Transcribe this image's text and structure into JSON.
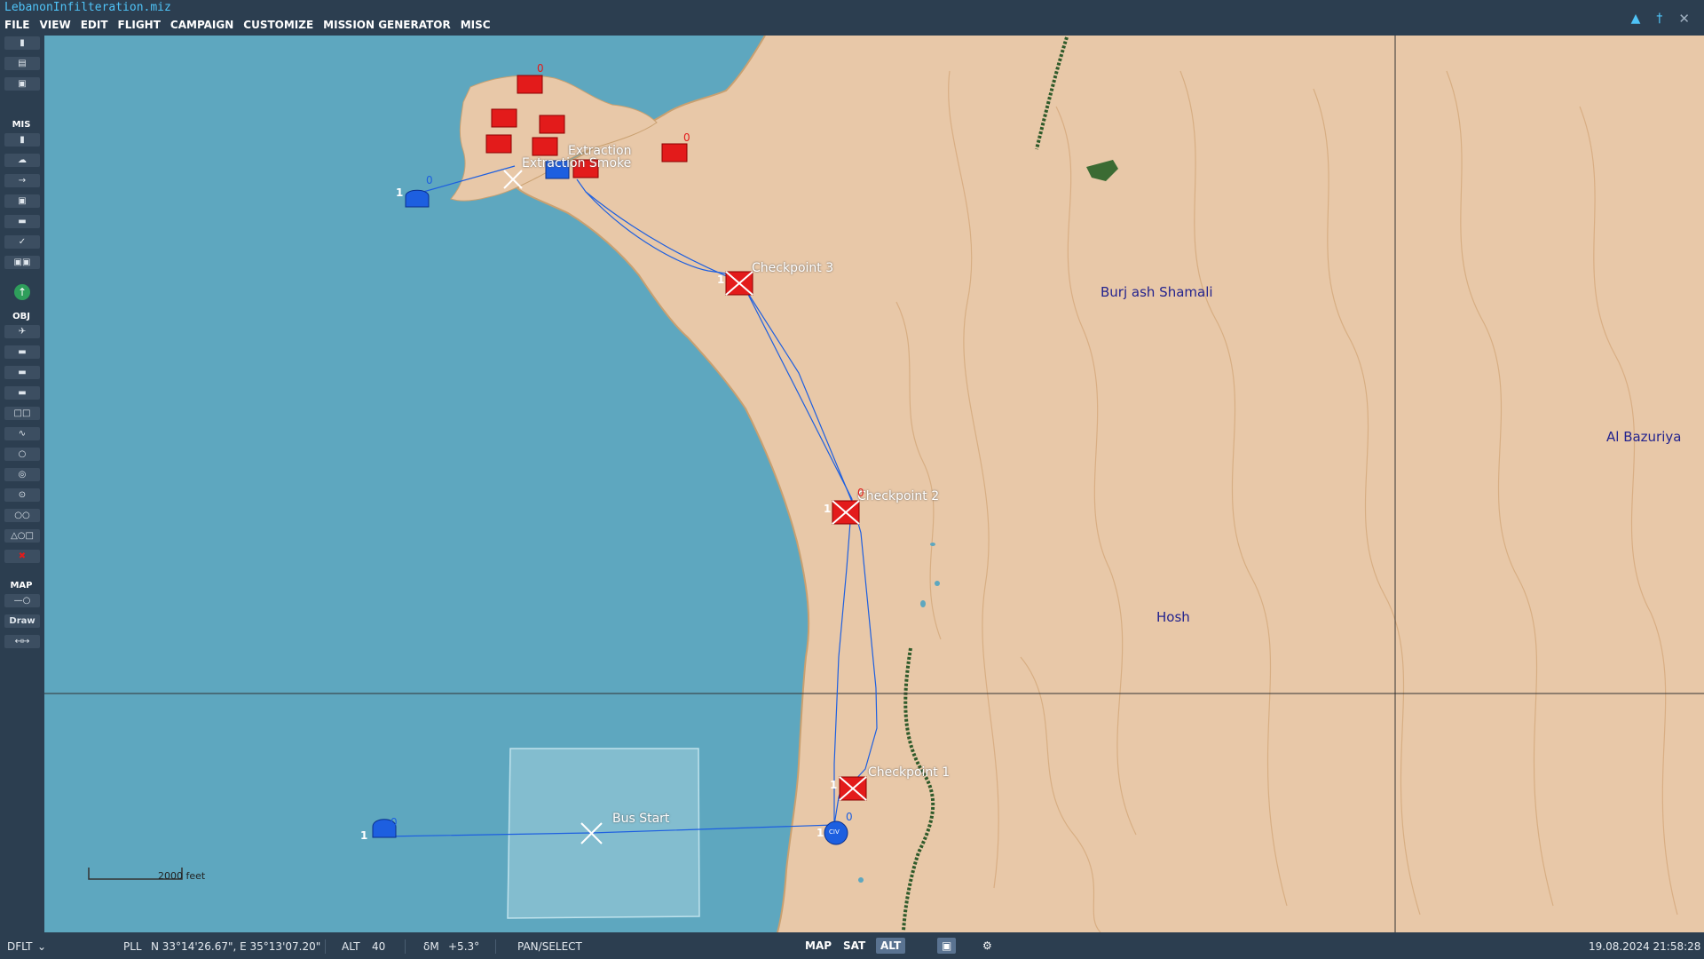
{
  "window": {
    "title": "LebanonInfilteration.miz"
  },
  "menu": [
    "FILE",
    "VIEW",
    "EDIT",
    "FLIGHT",
    "CAMPAIGN",
    "CUSTOMIZE",
    "MISSION GENERATOR",
    "MISC"
  ],
  "toolbar": {
    "mis_label": "MIS",
    "obj_label": "OBJ",
    "map_label": "MAP",
    "draw_label": "Draw"
  },
  "map": {
    "towns": [
      "Burj ash Shamali",
      "Al Bazuriya",
      "Hosh"
    ],
    "waypoints": [
      "Checkpoint 3",
      "Checkpoint 2",
      "Checkpoint 1",
      "Bus Start",
      "Extraction Smoke",
      "Extraction"
    ],
    "group_index": "1",
    "group_zero": "0",
    "civ_label": "CIV",
    "scale_label": "2000 feet"
  },
  "status": {
    "profile": "DFLT",
    "coord_label": "PLL",
    "coords": "N 33°14'26.67\", E 35°13'07.20\"",
    "alt_label": "ALT",
    "alt_value": "40",
    "mag_label": "δM",
    "mag_value": "+5.3°",
    "mode": "PAN/SELECT",
    "map_modes": [
      "MAP",
      "SAT",
      "ALT"
    ],
    "datetime": "19.08.2024 21:58:28"
  },
  "colors": {
    "sea": "#5ea7bf",
    "land": "#e8c8a8",
    "red": "#e31b1b",
    "blue": "#1d5fe0",
    "ui_bg": "#2c3e50",
    "accent": "#4fc3f7"
  }
}
